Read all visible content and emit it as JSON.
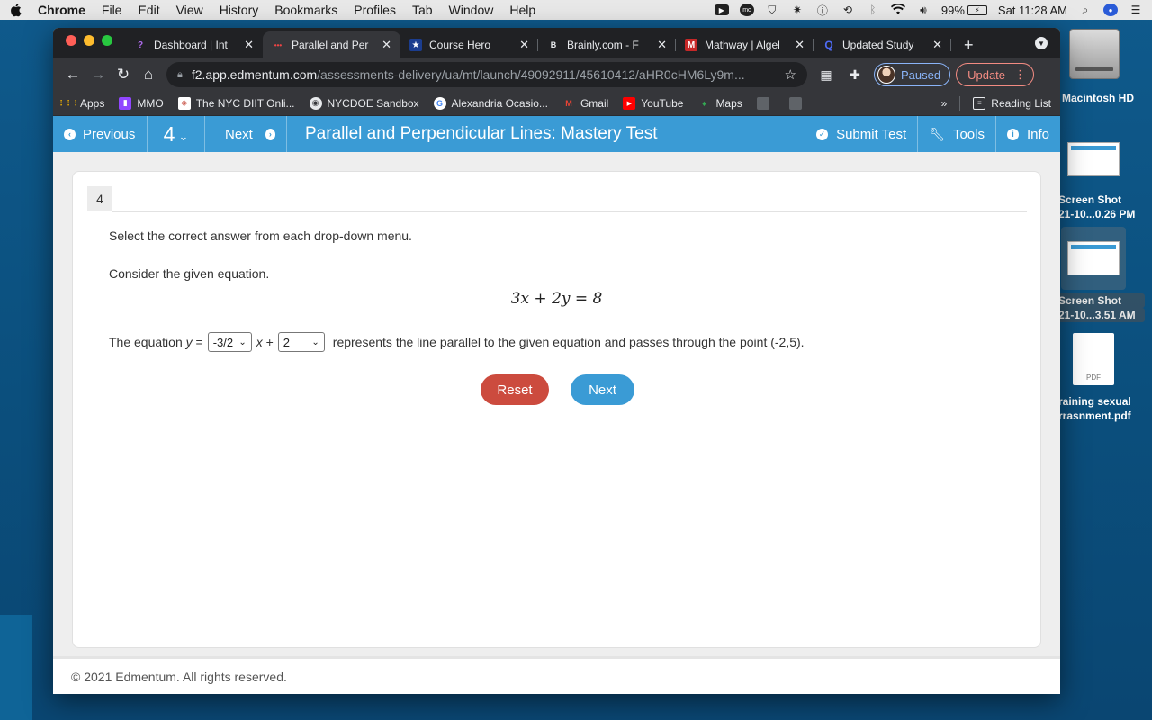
{
  "menubar": {
    "app": "Chrome",
    "items": [
      "File",
      "Edit",
      "View",
      "History",
      "Bookmarks",
      "Profiles",
      "Tab",
      "Window",
      "Help"
    ],
    "battery_pct": "99%",
    "clock": "Sat 11:28 AM"
  },
  "desktop": {
    "hd_label": "Macintosh HD",
    "shot1_line1": "Screen Shot",
    "shot1_line2": "21-10...0.26 PM",
    "shot2_line1": "Screen Shot",
    "shot2_line2": "21-10...3.51 AM",
    "pdf_badge": "PDF",
    "pdf_line1": "raining sexual",
    "pdf_line2": "rrasnment.pdf"
  },
  "tabs": [
    {
      "title": "Dashboard | Int",
      "fav": "?",
      "favColor": "#b06cf0"
    },
    {
      "title": "Parallel and Per",
      "fav": "•••",
      "favColor": "#e44"
    },
    {
      "title": "Course Hero",
      "fav": "★",
      "favColor": "#1b3d8f"
    },
    {
      "title": "Brainly.com - F",
      "fav": "B",
      "favColor": "#202124"
    },
    {
      "title": "Mathway | Algel",
      "fav": "M",
      "favColor": "#c62828"
    },
    {
      "title": "Updated Study",
      "fav": "Q",
      "favColor": "#4f6cf7"
    }
  ],
  "address": {
    "host": "f2.app.edmentum.com",
    "path": "/assessments-delivery/ua/mt/launch/49092911/45610412/aHR0cHM6Ly9m..."
  },
  "profile": {
    "paused_label": "Paused",
    "update_label": "Update"
  },
  "bookmarks": [
    {
      "label": "Apps",
      "ico": "⋮⋮",
      "color": "#f4b400"
    },
    {
      "label": "MMO",
      "ico": "▮",
      "color": "#9146ff"
    },
    {
      "label": "The NYC DIIT Onli...",
      "ico": "◈",
      "color": "#c0392b"
    },
    {
      "label": "NYCDOE Sandbox",
      "ico": "◉",
      "color": "#e8eaed"
    },
    {
      "label": "Alexandria Ocasio...",
      "ico": "G",
      "color": "#4285f4"
    },
    {
      "label": "Gmail",
      "ico": "M",
      "color": "#ea4335"
    },
    {
      "label": "YouTube",
      "ico": "▶",
      "color": "#ff0000"
    },
    {
      "label": "Maps",
      "ico": "♦",
      "color": "#34a853"
    }
  ],
  "reading_list": "Reading List",
  "app": {
    "prev_label": "Previous",
    "question_num": "4",
    "next_label": "Next",
    "title": "Parallel and Perpendicular Lines: Mastery Test",
    "submit_label": "Submit Test",
    "tools_label": "Tools",
    "info_label": "Info"
  },
  "question": {
    "number": "4",
    "instruction": "Select the correct answer from each drop-down menu.",
    "prompt": "Consider the given equation.",
    "equation": "3x + 2y = 8",
    "answer_prefix": "The equation",
    "answer_var": "y",
    "answer_eq": "=",
    "slope_value": "-3/2",
    "x_term": "x",
    "plus": "+",
    "intercept_value": "2",
    "answer_suffix": "represents the line parallel to the given equation and passes through the point (-2,5).",
    "reset_label": "Reset",
    "next_label": "Next"
  },
  "footer": "© 2021 Edmentum. All rights reserved."
}
